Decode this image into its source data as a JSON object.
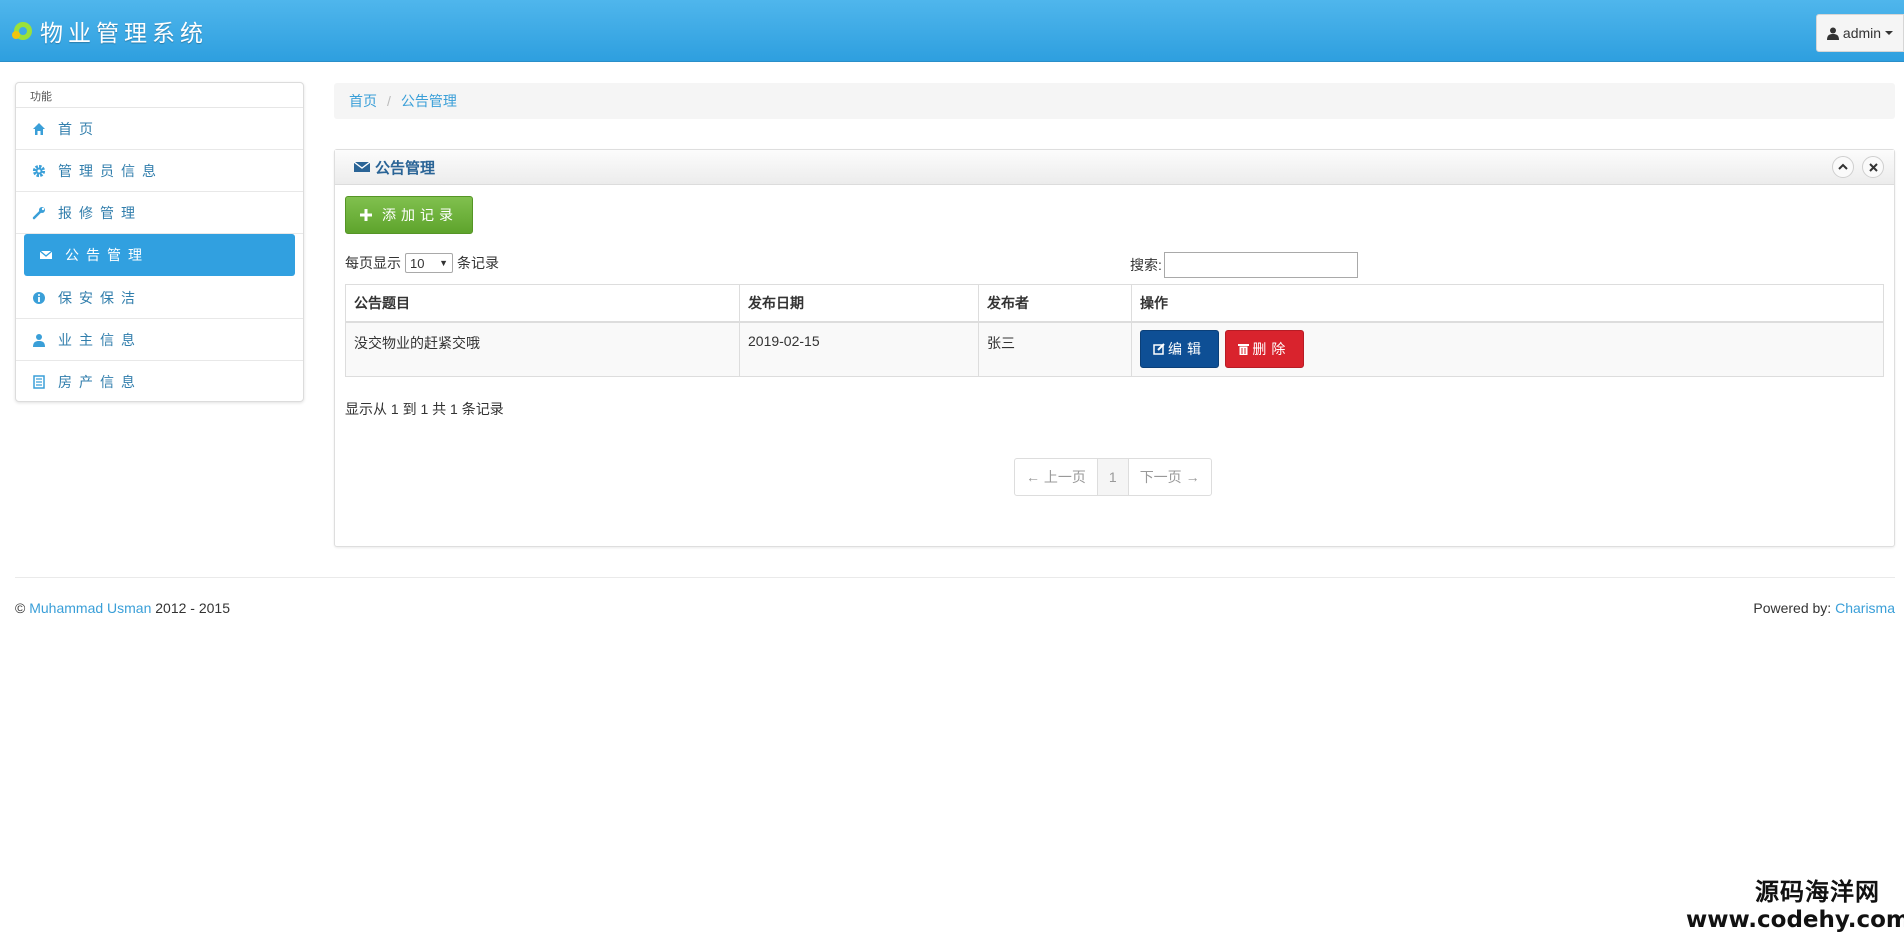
{
  "header": {
    "brand": "物业管理系统",
    "user": "admin"
  },
  "sidebar": {
    "title": "功能",
    "items": [
      {
        "label": "首页",
        "icon": "home-icon"
      },
      {
        "label": "管理员信息",
        "icon": "gear-icon"
      },
      {
        "label": "报修管理",
        "icon": "wrench-icon"
      },
      {
        "label": "公告管理",
        "icon": "envelope-icon",
        "active": true
      },
      {
        "label": "保安保洁",
        "icon": "info-icon"
      },
      {
        "label": "业主信息",
        "icon": "user-icon"
      },
      {
        "label": "房产信息",
        "icon": "list-icon"
      }
    ]
  },
  "breadcrumb": {
    "home": "首页",
    "current": "公告管理"
  },
  "panel": {
    "title": "公告管理"
  },
  "toolbar": {
    "add_label": "添加记录"
  },
  "length": {
    "prefix": "每页显示",
    "value": "10",
    "suffix": "条记录"
  },
  "search": {
    "label": "搜索:",
    "value": ""
  },
  "table": {
    "headers": [
      "公告题目",
      "发布日期",
      "发布者",
      "操作"
    ],
    "rows": [
      {
        "title": "没交物业的赶紧交哦",
        "date": "2019-02-15",
        "author": "张三",
        "edit": "编辑",
        "delete": "删除"
      }
    ]
  },
  "info": "显示从 1 到 1 共 1 条记录",
  "pager": {
    "prev": "← 上一页",
    "page": "1",
    "next": "下一页 →"
  },
  "footer": {
    "copyright": "©",
    "author_link": "Muhammad Usman",
    "years": "2012 - 2015",
    "powered_by": "Powered by:",
    "powered_link": "Charisma"
  },
  "watermark": {
    "cn": "源码海洋网",
    "url": "www.codehy.com"
  },
  "colors": {
    "navbar": "#2e9fdf",
    "active": "#31a0e0",
    "add": "#5ea42c",
    "edit": "#0e4f95",
    "delete": "#d9232d"
  }
}
